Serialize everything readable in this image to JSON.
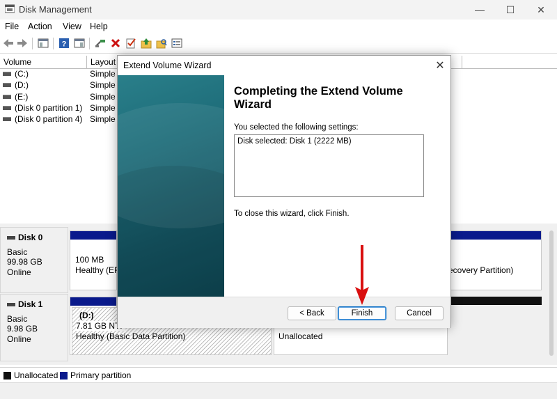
{
  "app": {
    "title": "Disk Management"
  },
  "window_controls": {
    "minimize": "—",
    "maximize": "☐",
    "close": "✕"
  },
  "menu": {
    "items": [
      "File",
      "Action",
      "View",
      "Help"
    ]
  },
  "toolbar": {
    "icons": [
      "back-icon",
      "forward-icon",
      "show-hide-console-tree-icon",
      "help-icon",
      "properties-icon",
      "connect-icon",
      "delete-icon",
      "check-icon",
      "up-folder-icon",
      "search-folder-icon",
      "list-view-icon"
    ]
  },
  "volume_list": {
    "columns": [
      "Volume",
      "Layout"
    ],
    "rows": [
      {
        "volume": "(C:)",
        "layout": "Simple"
      },
      {
        "volume": "(D:)",
        "layout": "Simple"
      },
      {
        "volume": "(E:)",
        "layout": "Simple"
      },
      {
        "volume": "(Disk 0 partition 1)",
        "layout": "Simple"
      },
      {
        "volume": "(Disk 0 partition 4)",
        "layout": "Simple"
      }
    ]
  },
  "disks": [
    {
      "name": "Disk 0",
      "type": "Basic",
      "size": "99.98 GB",
      "status": "Online",
      "partitions": [
        {
          "size": "100 MB",
          "status": "Healthy (EFI"
        },
        {
          "status": "ecovery Partition)"
        }
      ]
    },
    {
      "name": "Disk 1",
      "type": "Basic",
      "size": "9.98 GB",
      "status": "Online",
      "partitions": [
        {
          "label": "(D:)",
          "size": "7.81 GB NTF",
          "status": "Healthy (Basic Data Partition)"
        },
        {
          "status": "Unallocated"
        }
      ]
    }
  ],
  "legend": {
    "items": [
      {
        "label": "Unallocated",
        "color": "#111111"
      },
      {
        "label": "Primary partition",
        "color": "#0a1a8c"
      }
    ]
  },
  "dialog": {
    "title": "Extend Volume Wizard",
    "heading": "Completing the Extend Volume Wizard",
    "selected_label": "You selected the following settings:",
    "settings_text": "Disk selected: Disk 1 (2222 MB)",
    "close_text": "To close this wizard, click Finish.",
    "buttons": {
      "back": "< Back",
      "finish": "Finish",
      "cancel": "Cancel"
    },
    "close_glyph": "✕"
  },
  "colors": {
    "accent": "#0067c0",
    "primary_partition": "#0a1a8c",
    "annotation_arrow": "#d90f0f"
  }
}
